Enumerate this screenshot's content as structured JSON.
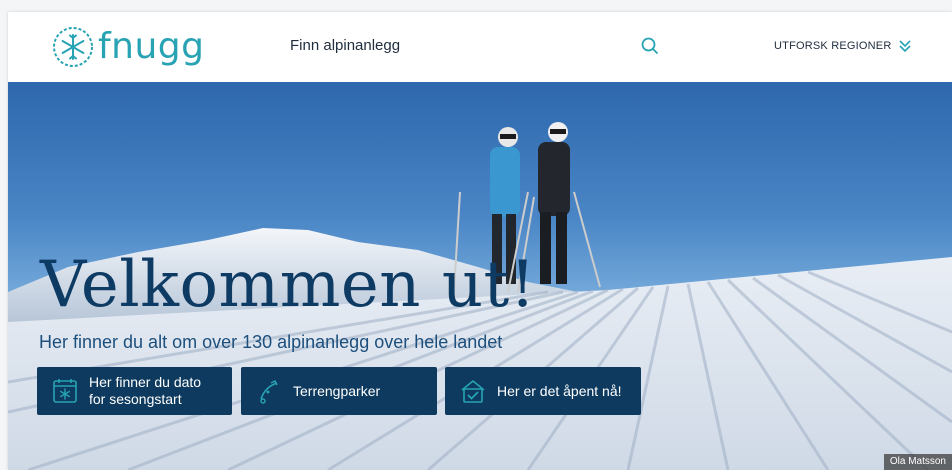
{
  "header": {
    "logo_text": "fnugg",
    "search_label": "Finn alpinanlegg",
    "regions_label": "UTFORSK REGIONER"
  },
  "hero": {
    "title": "Velkommen ut!",
    "subtitle": "Her finner du alt om over 130 alpinanlegg over hele landet",
    "buttons": [
      {
        "line1": "Her finner du dato",
        "line2": "for sesongstart",
        "icon": "calendar-snowflake-icon"
      },
      {
        "label": "Terrengparker",
        "icon": "terrain-park-icon"
      },
      {
        "label": "Her er det åpent nå!",
        "icon": "open-lodge-icon"
      }
    ],
    "photo_credit": "Ola Matsson"
  },
  "colors": {
    "brand": "#27a3b4",
    "button_bg": "#0d3a5e",
    "title": "#0e3b63"
  }
}
